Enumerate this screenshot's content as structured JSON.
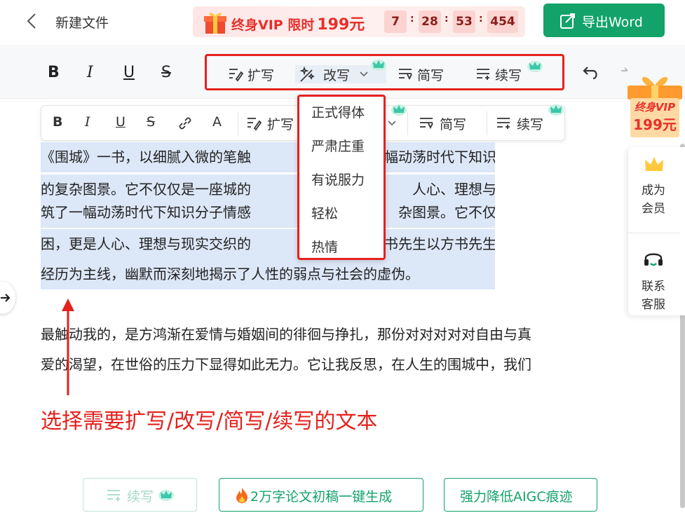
{
  "header": {
    "title": "新建文件",
    "promo": {
      "text": "终身VIP 限时",
      "price": "199元",
      "countdown": [
        "7",
        "28",
        "53",
        "454"
      ],
      "separator": ":"
    },
    "export_label": "导出Word"
  },
  "toolbar": {
    "bold": "B",
    "italic": "I",
    "underline": "U",
    "strike": "S",
    "expand": "扩写",
    "rewrite": "改写",
    "simplify": "简写",
    "continue": "续写"
  },
  "float_toolbar": {
    "bold": "B",
    "italic": "I",
    "underline": "U",
    "strike": "S",
    "font": "A",
    "expand": "扩写",
    "simplify": "简写",
    "continue": "续写"
  },
  "rewrite_menu": [
    "正式得体",
    "严肃庄重",
    "有说服力",
    "轻松",
    "热情"
  ],
  "content": {
    "para1": [
      "《围城》一书，以细腻入微的笔触",
      "的复杂图景。它不仅仅是一座城的",
      "筑了一幅动荡时代下知识分子情感",
      "困，更是人心、理想与现实交织的",
      "经历为主线，幽默而深刻地揭示了人性的弱点与社会的虚伪。"
    ],
    "para1_right": [
      "幅动荡时代下知识分子情感与生活",
      "人心、理想与现实交织的牢笼。构",
      "杂图景。它不仅仅是一座城的围",
      "书先生以方书先生以方鸿渐的婚恋",
      ""
    ],
    "para2": [
      "最触动我的，是方鸿渐在爱情与婚姻间的徘徊与挣扎，那份对对对对对自由与真",
      "爱的渴望，在世俗的压力下显得如此无力。它让我反思，在人生的围城中，我们"
    ],
    "annotation": "选择需要扩写/改写/简写/续写的文本"
  },
  "side_panel": {
    "vip_badge": [
      "终身VIP",
      "199元"
    ],
    "member_label": [
      "成为",
      "会员"
    ],
    "service_label": [
      "联系",
      "客服"
    ]
  },
  "bottom": {
    "continue": "续写",
    "thesis": "2万字论文初稿一键生成",
    "aigc": "强力降低AIGC痕迹"
  },
  "colors": {
    "accent_green": "#13a36a",
    "alert_red": "#e5211d",
    "selection": "#dce7f7",
    "crown_teal": "#3cc7a8"
  },
  "icons": [
    "back-icon",
    "gift-icon",
    "export-icon",
    "expand-icon",
    "rewrite-icon",
    "simplify-icon",
    "continue-icon",
    "crown-icon",
    "undo-icon",
    "redo-icon",
    "link-icon",
    "chevron-down-icon",
    "member-crown-icon",
    "headset-icon",
    "arrow-right-icon",
    "fire-icon"
  ]
}
